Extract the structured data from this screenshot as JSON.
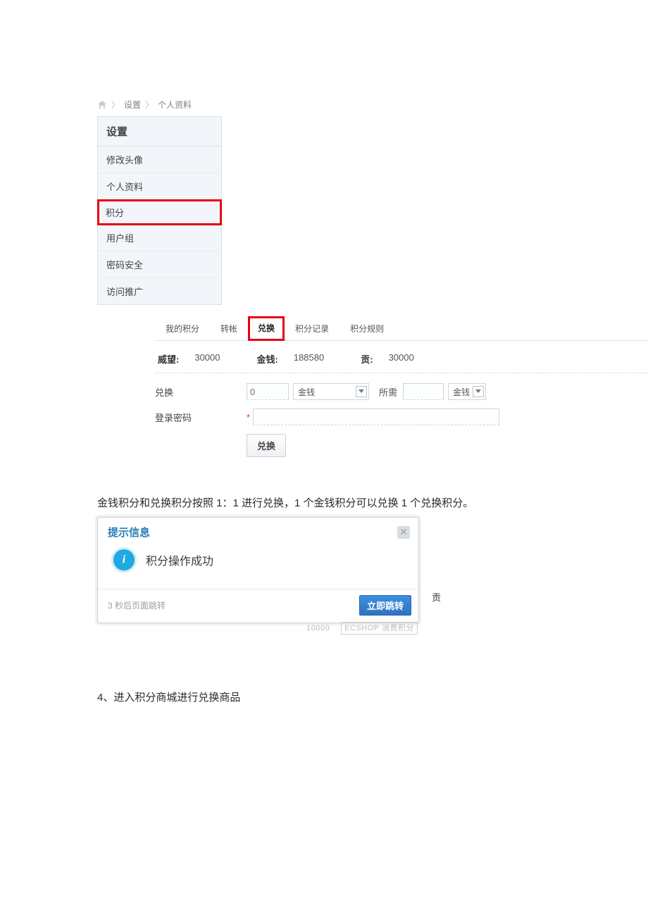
{
  "breadcrumb": {
    "item1": "设置",
    "item2": "个人资料"
  },
  "sidebar": {
    "header": "设置",
    "items": [
      "修改头像",
      "个人资料",
      "积分",
      "用户组",
      "密码安全",
      "访问推广"
    ]
  },
  "tabs": [
    "我的积分",
    "转帐",
    "兑换",
    "积分记录",
    "积分规则"
  ],
  "stats": {
    "l1": "威望:",
    "v1": "30000",
    "l2": "金钱:",
    "v2": "188580",
    "l3": "贡:",
    "v3": "30000"
  },
  "form": {
    "exchange_label": "兑换",
    "qty_placeholder": "0",
    "currency1": "金钱",
    "need_label": "所需",
    "currency2": "金钱",
    "password_label": "登录密码",
    "submit": "兑换"
  },
  "paragraph1": "金钱积分和兑换积分按照 1：1 进行兑换，1 个金钱积分可以兑换 1 个兑换积分。",
  "modal": {
    "title": "提示信息",
    "message": "积分操作成功",
    "countdown": "3 秒后页面跳转",
    "jump": "立即跳转",
    "under_num": "10000",
    "under_text": "ECSHOP 消费积分"
  },
  "side_char": "贡",
  "paragraph2": "4、进入积分商城进行兑换商品"
}
